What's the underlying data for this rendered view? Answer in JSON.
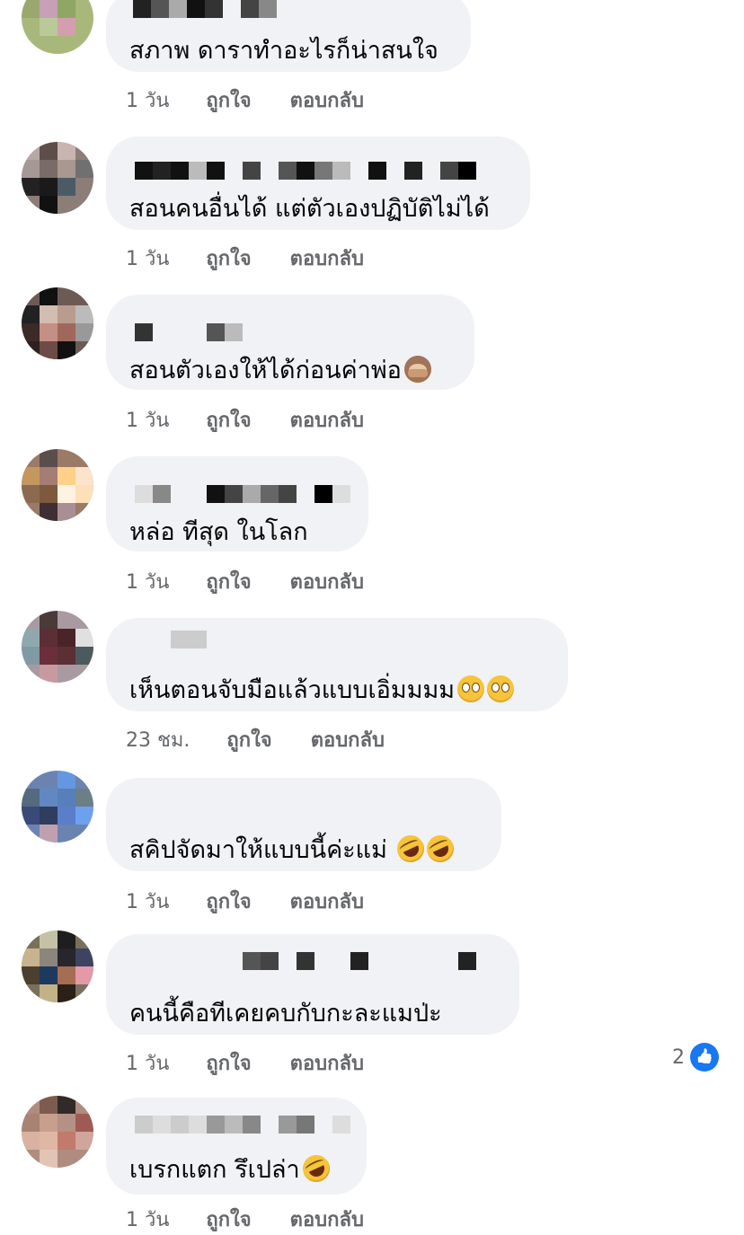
{
  "comments": [
    {
      "text": "สภาพ ดาราทำอะไรก็น่าสนใจ",
      "time": "1 วัน",
      "like": "ถูกใจ",
      "reply": "ตอบกลับ",
      "emojis": []
    },
    {
      "text": "สอนคนอื่นได้ แต่ตัวเองปฏิบัติไม่ได้",
      "time": "1 วัน",
      "like": "ถูกใจ",
      "reply": "ตอบกลับ",
      "emojis": []
    },
    {
      "text": "สอนตัวเองให้ได้ก่อนค่าพ่อ",
      "time": "1 วัน",
      "like": "ถูกใจ",
      "reply": "ตอบกลับ",
      "emojis": [
        "speak-no-evil-monkey"
      ]
    },
    {
      "text": "หล่อ ทีสุด ในโลก",
      "time": "1 วัน",
      "like": "ถูกใจ",
      "reply": "ตอบกลับ",
      "emojis": []
    },
    {
      "text": "เห็นตอนจับมือแล้วแบบเอิ่มมมม",
      "time": "23 ชม.",
      "like": "ถูกใจ",
      "reply": "ตอบกลับ",
      "emojis": [
        "eye-roll-face",
        "eye-roll-face"
      ]
    },
    {
      "text": "สคิปจัดมาให้แบบนี้ค่ะแม่",
      "time": "1 วัน",
      "like": "ถูกใจ",
      "reply": "ตอบกลับ",
      "emojis": [
        "rofl-face",
        "rofl-face"
      ]
    },
    {
      "text": "คนนี้คือทีเคยคบกับกะละแมป่ะ",
      "time": "1 วัน",
      "like": "ถูกใจ",
      "reply": "ตอบกลับ",
      "emojis": [],
      "reaction_count": "2"
    },
    {
      "text": "เบรกแตก รึเปล่า",
      "time": "1 วัน",
      "like": "ถูกใจ",
      "reply": "ตอบกลับ",
      "emojis": [
        "rofl-face"
      ]
    }
  ],
  "colors": {
    "bubble": "#f0f2f5",
    "meta_text": "#65676b",
    "like_blue": "#1877f2"
  }
}
